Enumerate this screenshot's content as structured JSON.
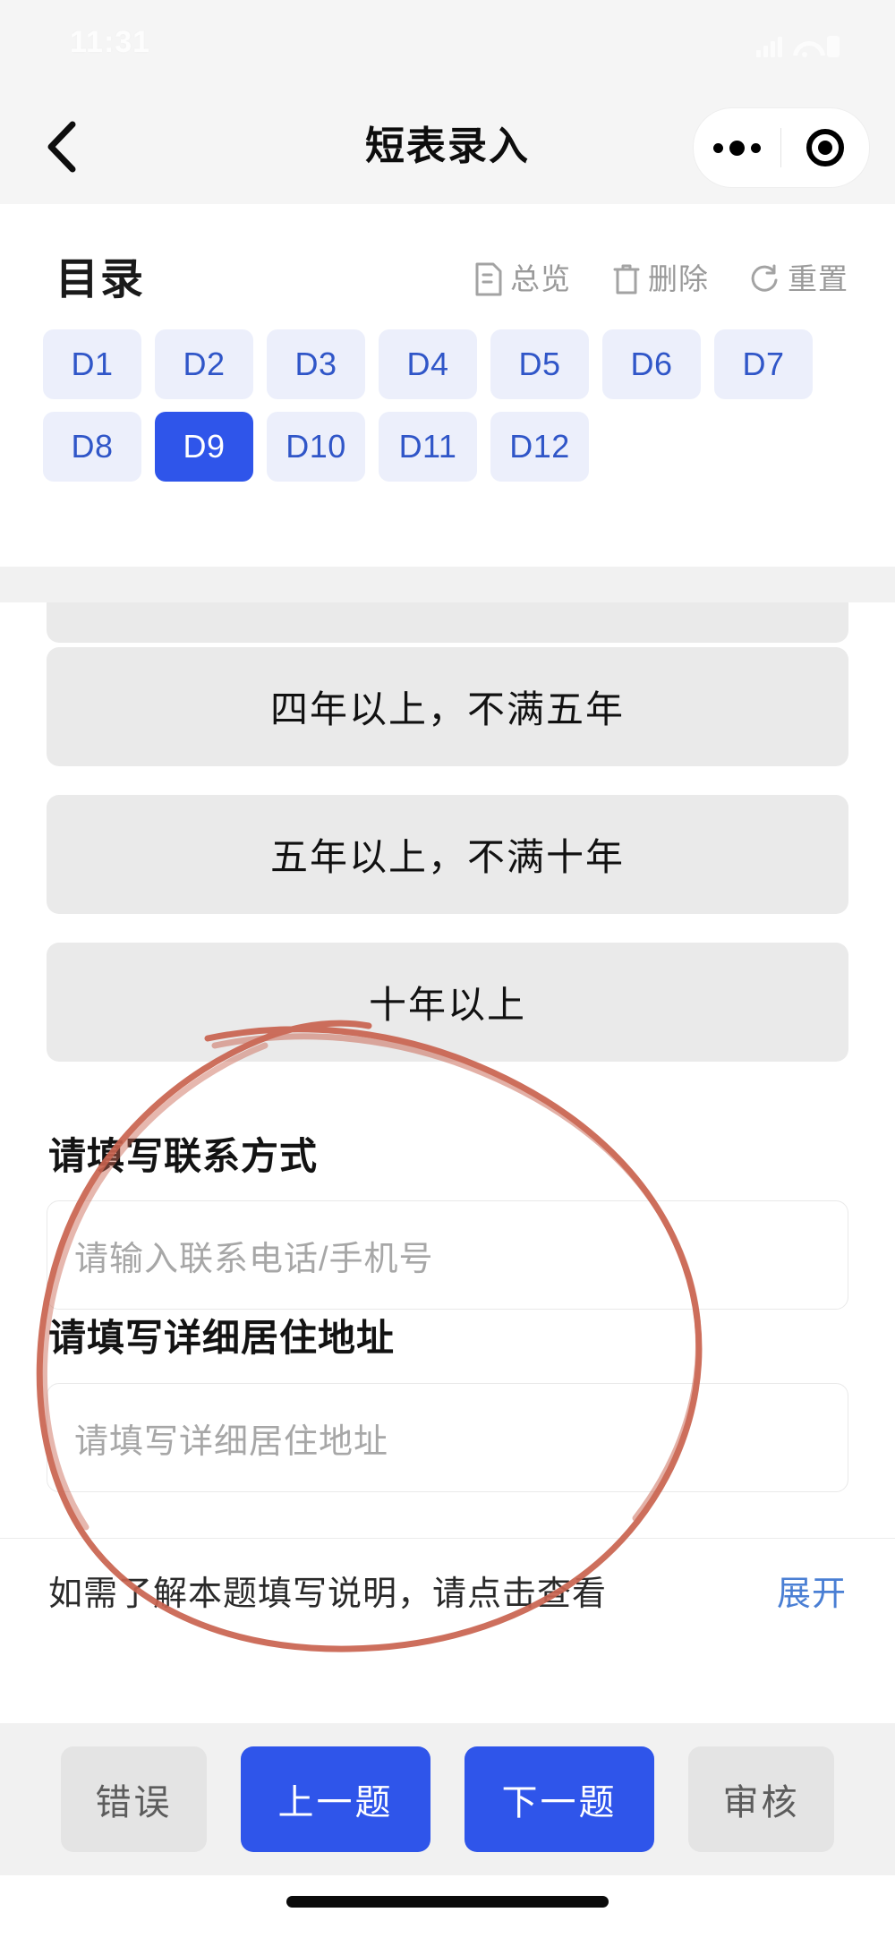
{
  "status_bar": {
    "time": "11:31",
    "icons": [
      "signal-icon",
      "wifi-icon",
      "battery-icon"
    ]
  },
  "nav": {
    "back_icon": "chevron-left-icon",
    "title": "短表录入",
    "capsule": {
      "more_icon": "more-dots-icon",
      "target_icon": "target-icon"
    }
  },
  "directory": {
    "title": "目录",
    "actions": [
      {
        "label": "总览",
        "icon": "document-icon"
      },
      {
        "label": "删除",
        "icon": "trash-icon"
      },
      {
        "label": "重置",
        "icon": "reset-icon"
      }
    ],
    "chips_row1": [
      "D1",
      "D2",
      "D3",
      "D4",
      "D5",
      "D6",
      "D7"
    ],
    "chips_row2": [
      "D8",
      "D9",
      "D10",
      "D11",
      "D12"
    ],
    "selected_chip": "D9"
  },
  "question": {
    "options": [
      "四年以上，不满五年",
      "五年以上，不满十年",
      "十年以上"
    ],
    "fields": [
      {
        "label": "请填写联系方式",
        "placeholder": "请输入联系电话/手机号",
        "value": ""
      },
      {
        "label": "请填写详细居住地址",
        "placeholder": "请填写详细居住地址",
        "value": ""
      }
    ],
    "hint_text": "如需了解本题填写说明，请点击查看",
    "hint_link": "展开"
  },
  "bottom_bar": {
    "buttons": [
      {
        "label": "错误",
        "style": "ghost"
      },
      {
        "label": "上一题",
        "style": "primary"
      },
      {
        "label": "下一题",
        "style": "primary"
      },
      {
        "label": "审核",
        "style": "ghost"
      }
    ]
  },
  "annotation": {
    "type": "hand-drawn-ellipse",
    "color": "#c9634f"
  },
  "colors": {
    "accent_blue": "#2f55ea",
    "chip_bg": "#eceffb",
    "chip_text": "#3056c8",
    "option_bg": "#eaeaea",
    "link_blue": "#4a7fd4",
    "annotation_red": "#c9634f"
  }
}
